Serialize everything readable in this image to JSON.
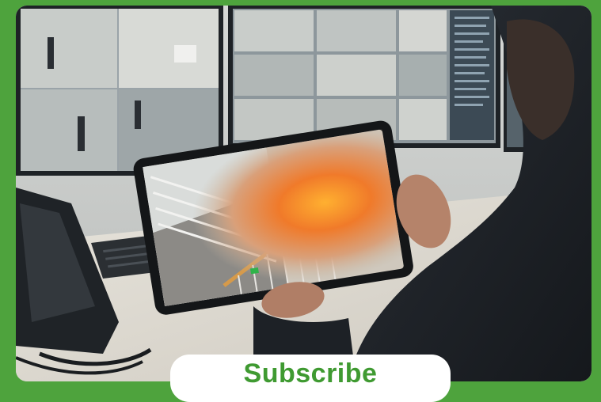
{
  "photo": {
    "subject": "security-monitoring-tablet-fire-scene"
  },
  "cta": {
    "label": "Subscribe"
  },
  "colors": {
    "frame_green": "#4ea33d",
    "cta_text": "#3f9a31",
    "cta_background": "#ffffff"
  }
}
